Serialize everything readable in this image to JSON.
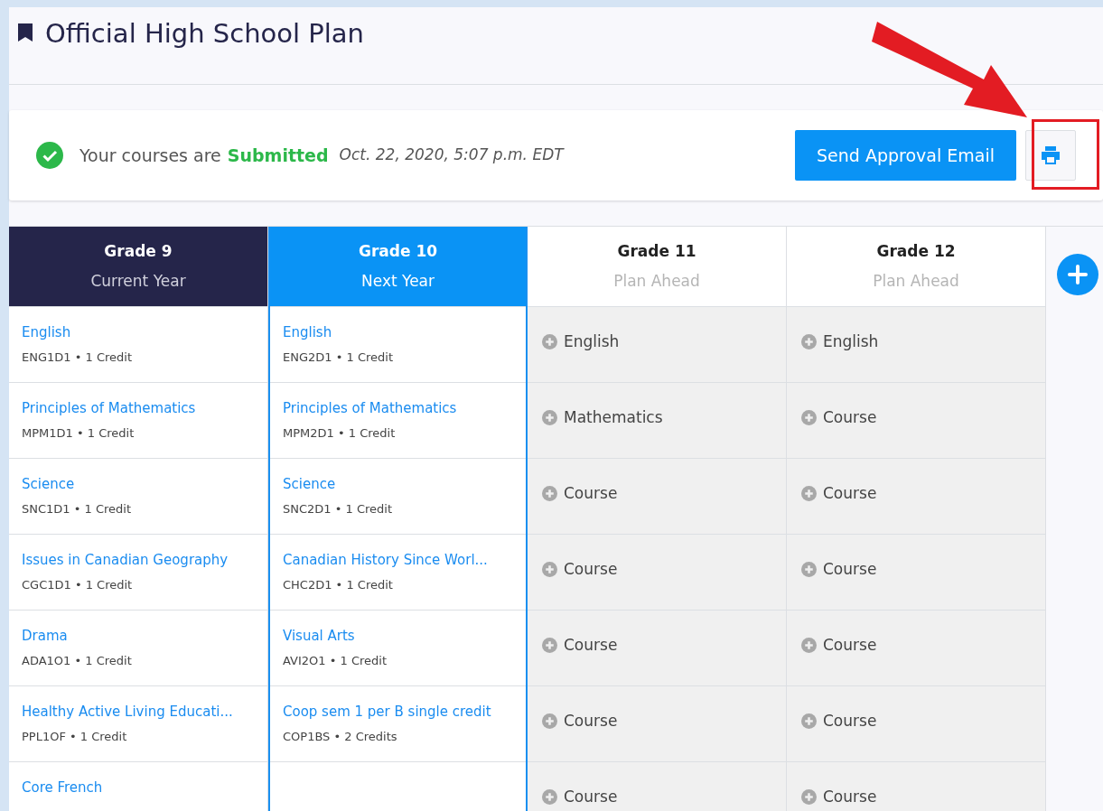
{
  "page": {
    "title": "Official High School Plan"
  },
  "status": {
    "prefix": "Your courses are",
    "state": "Submitted",
    "timestamp": "Oct. 22, 2020, 5:07 p.m. EDT",
    "send_button": "Send Approval Email"
  },
  "annotation": {
    "arrow": true,
    "highlight": true
  },
  "columns": [
    {
      "title": "Grade 9",
      "subtitle": "Current Year",
      "kind": "current",
      "selected": false,
      "courses": [
        {
          "kind": "course",
          "name": "English",
          "code": "ENG1D1 • 1 Credit"
        },
        {
          "kind": "course",
          "name": "Principles of Mathematics",
          "code": "MPM1D1 • 1 Credit"
        },
        {
          "kind": "course",
          "name": "Science",
          "code": "SNC1D1 • 1 Credit"
        },
        {
          "kind": "course",
          "name": "Issues in Canadian Geography",
          "code": "CGC1D1 • 1 Credit"
        },
        {
          "kind": "course",
          "name": "Drama",
          "code": "ADA1O1 • 1 Credit"
        },
        {
          "kind": "course",
          "name": "Healthy Active Living Educati...",
          "code": "PPL1OF • 1 Credit"
        },
        {
          "kind": "course",
          "name": "Core French"
        }
      ]
    },
    {
      "title": "Grade 10",
      "subtitle": "Next Year",
      "kind": "next",
      "selected": true,
      "courses": [
        {
          "kind": "course",
          "name": "English",
          "code": "ENG2D1 • 1 Credit"
        },
        {
          "kind": "course",
          "name": "Principles of Mathematics",
          "code": "MPM2D1 • 1 Credit"
        },
        {
          "kind": "course",
          "name": "Science",
          "code": "SNC2D1 • 1 Credit"
        },
        {
          "kind": "course",
          "name": "Canadian History Since Worl...",
          "code": "CHC2D1 • 1 Credit"
        },
        {
          "kind": "course",
          "name": "Visual Arts",
          "code": "AVI2O1 • 1 Credit"
        },
        {
          "kind": "course",
          "name": "Coop sem 1 per B single credit",
          "code": "COP1BS • 2 Credits"
        }
      ]
    },
    {
      "title": "Grade 11",
      "subtitle": "Plan Ahead",
      "kind": "plan",
      "selected": false,
      "courses": [
        {
          "kind": "placeholder",
          "name": "English"
        },
        {
          "kind": "placeholder",
          "name": "Mathematics"
        },
        {
          "kind": "placeholder",
          "name": "Course"
        },
        {
          "kind": "placeholder",
          "name": "Course"
        },
        {
          "kind": "placeholder",
          "name": "Course"
        },
        {
          "kind": "placeholder",
          "name": "Course"
        },
        {
          "kind": "placeholder",
          "name": "Course"
        }
      ]
    },
    {
      "title": "Grade 12",
      "subtitle": "Plan Ahead",
      "kind": "plan",
      "selected": false,
      "courses": [
        {
          "kind": "placeholder",
          "name": "English"
        },
        {
          "kind": "placeholder",
          "name": "Course"
        },
        {
          "kind": "placeholder",
          "name": "Course"
        },
        {
          "kind": "placeholder",
          "name": "Course"
        },
        {
          "kind": "placeholder",
          "name": "Course"
        },
        {
          "kind": "placeholder",
          "name": "Course"
        },
        {
          "kind": "placeholder",
          "name": "Course"
        }
      ]
    }
  ]
}
